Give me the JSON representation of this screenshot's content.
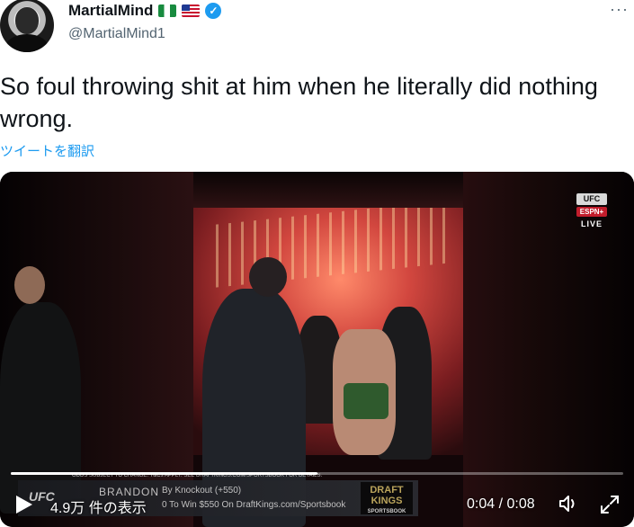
{
  "author": {
    "display_name": "MartialMind",
    "handle": "@MartialMind1",
    "flags": [
      "nigeria-flag",
      "usa-flag"
    ],
    "verified_icon": "verified-badge-icon"
  },
  "tweet": {
    "text": "So foul throwing shit at him when he literally did nothing wrong.",
    "translate_label": "ツイートを翻訳"
  },
  "video": {
    "overlay": {
      "network": "UFC",
      "network_sub": "ESPN+",
      "live_label": "LIVE",
      "fine_print": "ODDS SUBJECT TO CHANGE. T&Cs APPLY. SEE DRAFTKINGS.COM/SPORTSBOOK FOR DETAILS.",
      "ufc_logo": "UFC",
      "fighter": "BRANDON",
      "bet_line": "By Knockout (+550)",
      "bet_promo": "0 To Win $550 On DraftKings.com/Sportsbook",
      "sponsor": "DRAFT KINGS",
      "sponsor_sub": "SPORTSBOOK"
    },
    "views": "4.9万 件の表示",
    "time": "0:04 / 0:08",
    "progress": 0.5
  },
  "colors": {
    "accent": "#1d9bf0",
    "text": "#0f1419",
    "secondary": "#536471"
  }
}
